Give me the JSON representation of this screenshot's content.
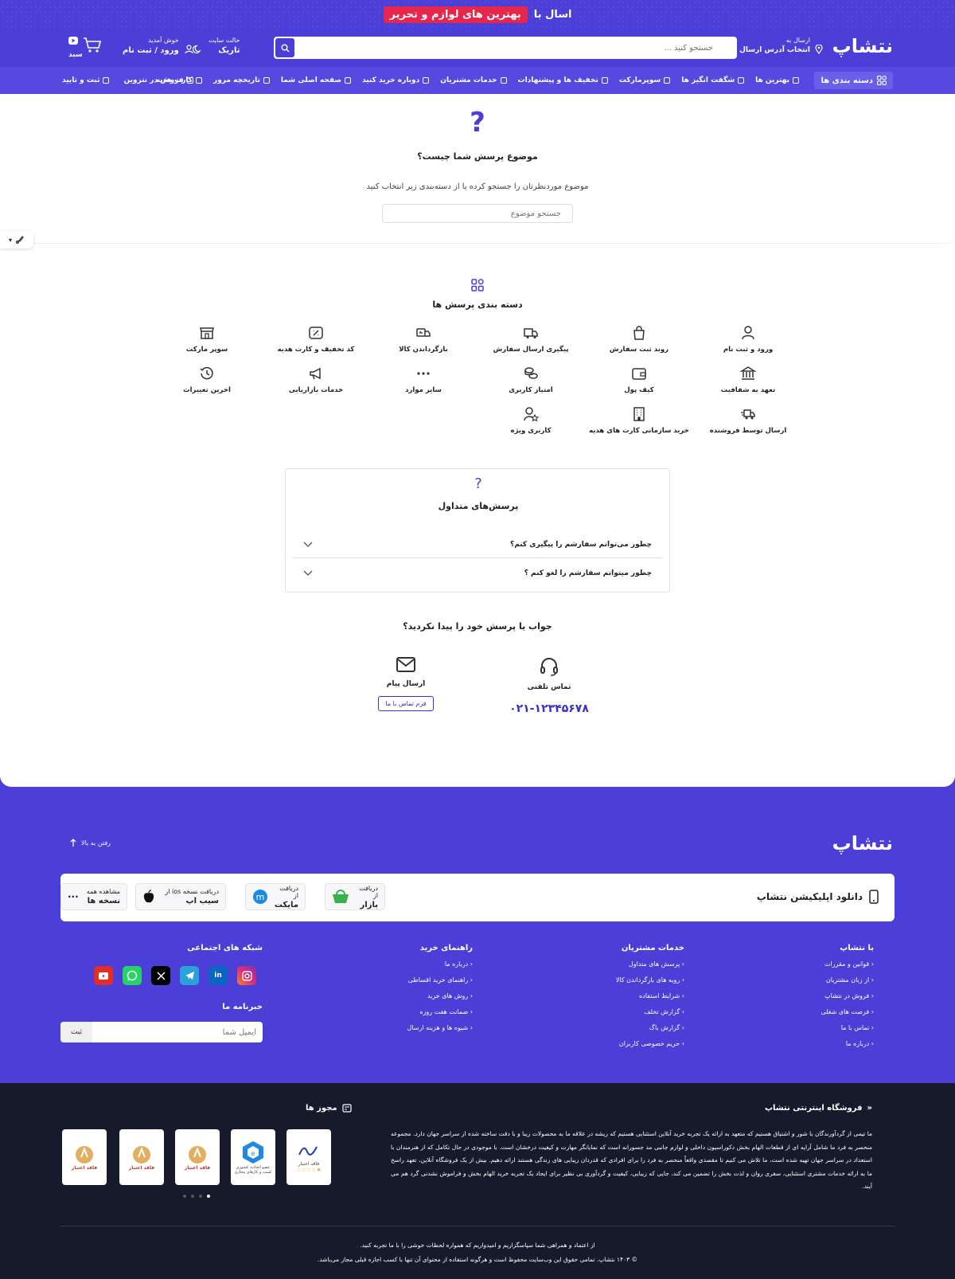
{
  "banner": {
    "prefix": "اسال با",
    "highlight": "بهترین های لوازم و تحریر"
  },
  "header": {
    "logo": "نتشاپ",
    "address_small": "ارسال به",
    "address_bold": "انتخاب آدرس ارسال",
    "search_placeholder": "جستجو کنید ...",
    "theme_small": "حالت سایت",
    "theme_bold": "تاریک",
    "login_small": "خوش آمدید",
    "login_bold": "ورود / ثبت نام",
    "cart_label": "سبد"
  },
  "nav": {
    "categories": "دسته بندی ها",
    "items": [
      "بهترین ها",
      "شگفت انگیز ها",
      "سوپرمارکت",
      "تخفیف ها و پیشنهادات",
      "خدمات مشتریان",
      "دوباره خرید کنید",
      "صفحه اصلی شما",
      "تاریخچه مرور",
      "کارت هدیه"
    ],
    "sell": "فروش در نتزوین",
    "register": "ثبت و تایید"
  },
  "question": {
    "title": "موضوع پرسش شما چیست؟",
    "subtitle": "موضوع موردنظرتان را جستجو کرده یا از دسته‌بندی زیر انتخاب کنید",
    "input_placeholder": "جستجو موضوع"
  },
  "categories": {
    "title": "دسته بندی پرسش ها",
    "items": [
      {
        "label": "ورود و ثبت نام",
        "icon": "user-icon"
      },
      {
        "label": "روند ثبت سفارش",
        "icon": "shopping-bag-icon"
      },
      {
        "label": "پیگیری ارسال سفارش",
        "icon": "truck-icon"
      },
      {
        "label": "بازگرداندن کالا",
        "icon": "return-truck-icon"
      },
      {
        "label": "کد تخفیف و کارت هدیه",
        "icon": "ticket-icon"
      },
      {
        "label": "سوپر مارکت",
        "icon": "store-icon"
      },
      {
        "label": "تعهد به شفافیت",
        "icon": "bank-icon"
      },
      {
        "label": "کیف پول",
        "icon": "wallet-icon"
      },
      {
        "label": "امتیاز کاربری",
        "icon": "coins-icon"
      },
      {
        "label": "سایر موارد",
        "icon": "more-icon"
      },
      {
        "label": "خدمات بازاریابی",
        "icon": "megaphone-icon"
      },
      {
        "label": "اخرین تغییرات",
        "icon": "history-icon"
      },
      {
        "label": "ارسال توسط فروشنده",
        "icon": "delivery-icon"
      },
      {
        "label": "خرید سازمانی کارت های هدیه",
        "icon": "building-icon"
      },
      {
        "label": "کاربری ویژه",
        "icon": "user-star-icon"
      }
    ]
  },
  "faq": {
    "title": "پرسش‌های متداول",
    "items": [
      "چطور می‌توانم سفارشم را پیگیری کنم؟",
      "چطور میتوانم سفارشم را لغو کنم ؟"
    ]
  },
  "contact": {
    "title": "جواب یا پرسش خود را پیدا نکردید؟",
    "phone_label": "تماس تلفنی",
    "phone_number": "۰۲۱-۱۲۳۴۵۶۷۸",
    "message_label": "ارسال پیام",
    "form_button": "فرم تماس با ما"
  },
  "footer": {
    "logo": "نتشاپ",
    "to_top": "رفتن به بالا",
    "app_title": "دانلود اپلیکیشن نتشاپ",
    "apps": [
      {
        "small": "دریافت از",
        "bold": "بازار"
      },
      {
        "small": "دریافت از",
        "bold": "مایکت"
      },
      {
        "small": "دریافت نسخه ios از",
        "bold": "سیب اپ"
      },
      {
        "small": "مشاهده همه",
        "bold": "نسخه ها"
      }
    ],
    "col1": {
      "title": "با نتشاپ",
      "links": [
        "قوانین و مقررات",
        "از زبان مشتریان",
        "فروش در نتشاپ",
        "فرصت های شغلی",
        "تماس با ما",
        "درباره ما"
      ]
    },
    "col2": {
      "title": "خدمات مشتریان",
      "links": [
        "پرسش های متداول",
        "رویه های بازگرداندن کالا",
        "شرایط استفاده",
        "گزارش تخلف",
        "گزارش باگ",
        "حریم خصوصی کاربران"
      ]
    },
    "col3": {
      "title": "راهنمای خرید",
      "links": [
        "درباره ما",
        "راهنمای خرید اقساطی",
        "روش های خرید",
        "ضمانت هفت روزه",
        "شیوه ها و هزینه ارسال"
      ]
    },
    "social_title": "شبکه های اجتماعی",
    "newsletter_title": "خبرنامه ما",
    "newsletter_placeholder": "ایمیل شما",
    "newsletter_submit": "ثبت"
  },
  "bottom": {
    "store_title": "فروشگاه اینترنتی نتشاپ",
    "about": "ما تیمی از گردآورندگان با شور و اشتیاق هستیم که متعهد به ارائه یک تجربه خرید آنلاین استثنایی هستیم که ریشه در علاقه ما به محصولات زیبا و با دقت ساخته شده از سراسر جهان دارد. مجموعه منحصر به فرد ما شامل آرایه ای از قطعات الهام بخش دکوراسیون داخلی و لوازم جانبی مد جسورانه است که نمایانگر مهارت و کیفیت درخشان است. با موجودی در حال تکامل که از هنرمندان با استعداد در سراسر جهان تهیه شده است، ما تلاش می کنیم تا مقصدی واقعاً منحصر به فرد را برای افرادی که قدردان زیبایی های زندگی هستند ارائه دهیم. بیش از یک فروشگاه آنلاین، تعهد راسخ ما به ارائه خدمات مشتری استثنایی، سفری روان و لذت بخش را تضمین می کند، جایی که زیبایی، کیفیت و گردآوری بی نظیر برای ایجاد یک تجربه خرید الهام بخش و فراموش نشدنی گرد هم می آیند.",
    "licenses_title": "مجوز ها",
    "badge_text": "فاقد اعتبار",
    "enamad_text": "عضو اتحادیه کشوری کسب و کارهای مجازی",
    "copy1": "از اعتماد و همراهی شما سپاسگزاریم و امیدواریم که همواره لحظات خوشی را با ما تجربه کنید.",
    "copy2": "© ۱۴۰۳ نتشاپ. تمامی حقوق این وب‌سایت محفوظ است و هرگونه استفاده از محتوای آن تنها با کسب اجازه قبلی مجاز می‌باشد."
  },
  "colors": {
    "primary": "#4b3fd8",
    "accent": "#e8254a",
    "dark": "#171a2b"
  }
}
